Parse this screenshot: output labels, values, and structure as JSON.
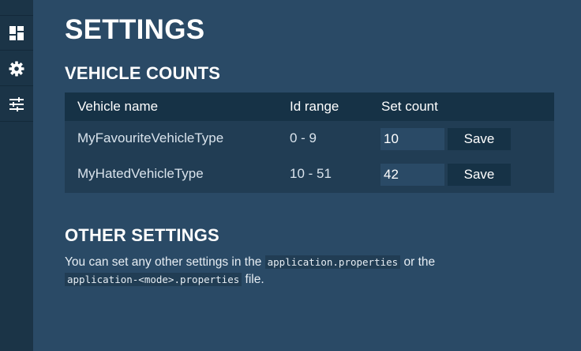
{
  "sidebar": {
    "items": [
      {
        "icon": "dashboard-icon"
      },
      {
        "icon": "gear-icon"
      },
      {
        "icon": "sliders-icon"
      }
    ]
  },
  "page": {
    "title": "SETTINGS"
  },
  "vehicle_counts": {
    "title": "VEHICLE COUNTS",
    "columns": [
      "Vehicle name",
      "Id range",
      "Set count"
    ],
    "rows": [
      {
        "name": "MyFavouriteVehicleType",
        "id_range": "0 - 9",
        "count": "10",
        "save_label": "Save"
      },
      {
        "name": "MyHatedVehicleType",
        "id_range": "10 - 51",
        "count": "42",
        "save_label": "Save"
      }
    ]
  },
  "other_settings": {
    "title": "OTHER SETTINGS",
    "text_1": "You can set any other settings in the ",
    "code_1": "application.properties",
    "text_2": " or the ",
    "code_2": "application-<mode>.properties",
    "text_3": " file."
  },
  "colors": {
    "background": "#2a4a66",
    "sidebar": "#1b3447",
    "table_header": "#163246",
    "table_body": "#213d54"
  }
}
